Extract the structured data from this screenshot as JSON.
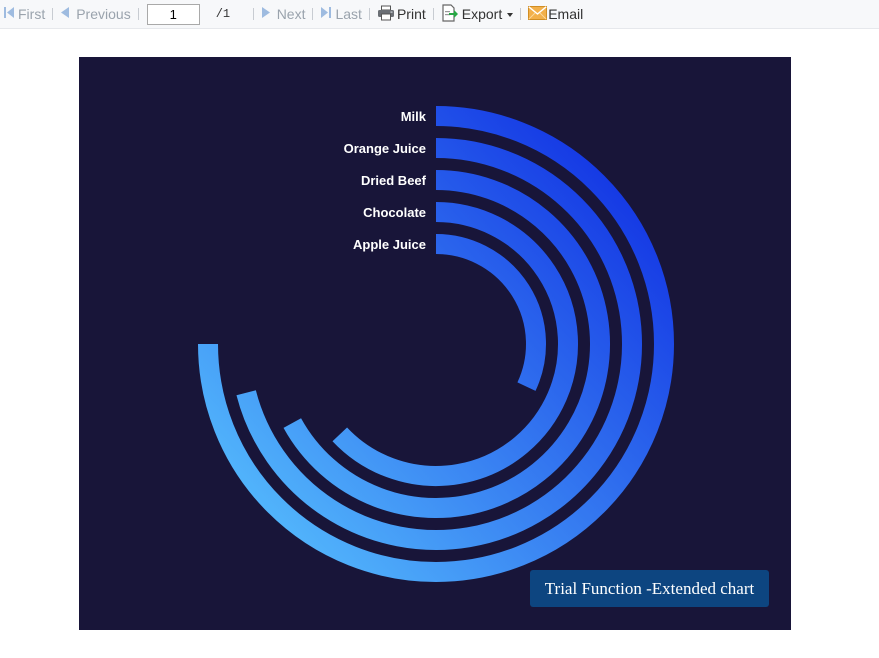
{
  "toolbar": {
    "first_label": "First",
    "previous_label": "Previous",
    "page_value": "1",
    "page_total": "/1",
    "next_label": "Next",
    "last_label": "Last",
    "print_label": "Print",
    "export_label": "Export",
    "email_label": "Email"
  },
  "chart_data": {
    "type": "radial-bar",
    "background": "#181539",
    "gradient": {
      "start": "#5bc8ff",
      "end": "#0a22e0"
    },
    "series": [
      {
        "name": "Milk",
        "fraction": 0.75
      },
      {
        "name": "Orange Juice",
        "fraction": 0.71
      },
      {
        "name": "Dried Beef",
        "fraction": 0.67
      },
      {
        "name": "Chocolate",
        "fraction": 0.63
      },
      {
        "name": "Apple Juice",
        "fraction": 0.32
      }
    ]
  },
  "watermark": {
    "text": "Trial Function -Extended chart"
  }
}
